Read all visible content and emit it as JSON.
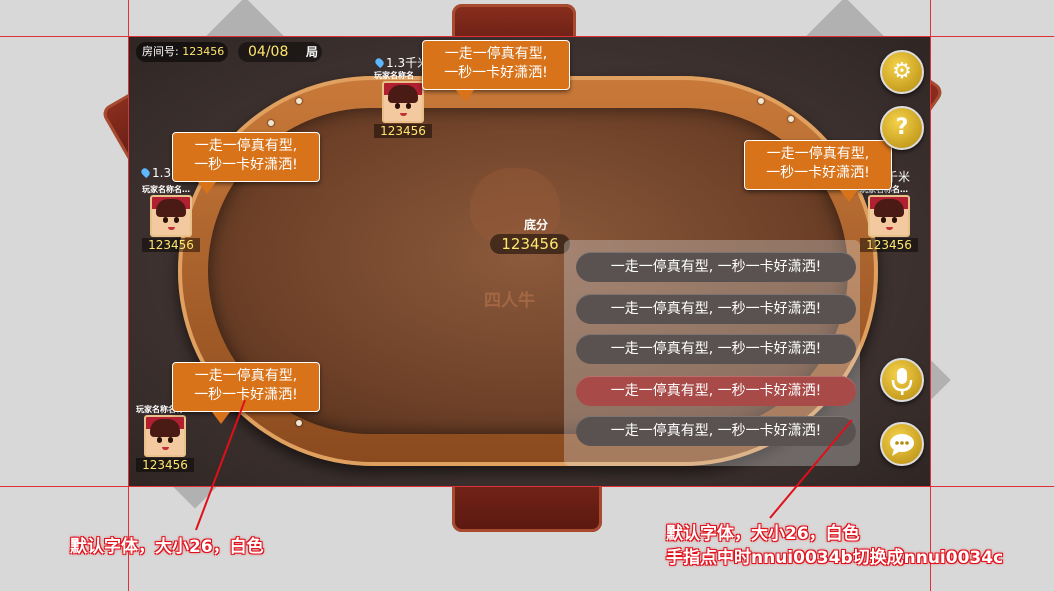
{
  "room": {
    "label": "房间号:",
    "number": "123456"
  },
  "round": {
    "current": "04/08",
    "unit": "局"
  },
  "center": {
    "base_label": "底分",
    "base_value": "123456",
    "logo_text": "四人牛"
  },
  "players": {
    "top": {
      "name": "玩家名称名",
      "score": "123456",
      "distance": "1.3千米"
    },
    "left": {
      "name": "玩家名称名…",
      "score": "123456",
      "distance": "1.3"
    },
    "right": {
      "name": "玩家名称名…",
      "score": "123456",
      "distance": "千米"
    },
    "bottom": {
      "name": "玩家名称名称…",
      "score": "123456"
    }
  },
  "bubbles": {
    "line1": "一走一停真有型,",
    "line2": "一秒一卡好潇洒!"
  },
  "quick_chat": {
    "items": [
      "一走一停真有型, 一秒一卡好潇洒!",
      "一走一停真有型, 一秒一卡好潇洒!",
      "一走一停真有型, 一秒一卡好潇洒!",
      "一走一停真有型, 一秒一卡好潇洒!",
      "一走一停真有型, 一秒一卡好潇洒!"
    ],
    "active_index": 3
  },
  "buttons": {
    "help_glyph": "?"
  },
  "annotations": {
    "left": "默认字体，大小26，白色",
    "right_line1": "默认字体，大小26，白色",
    "right_line2": "手指点中时nnui0034b切换成nnui0034c"
  },
  "colors": {
    "accent": "#ffe66d",
    "bubble": "#d8731a",
    "guide": "#e0303a",
    "active_chat": "#a84a48"
  }
}
